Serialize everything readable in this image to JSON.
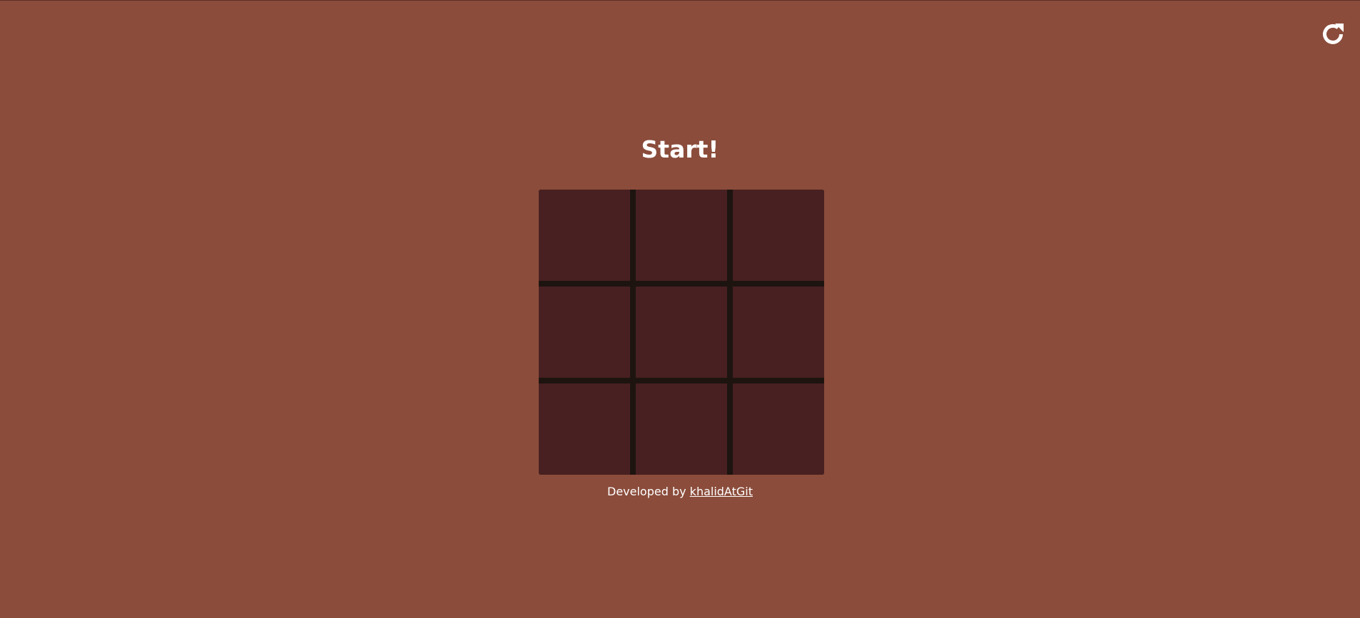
{
  "game": {
    "status_text": "Start!",
    "board": {
      "rows": 3,
      "cols": 3,
      "cells": [
        "",
        "",
        "",
        "",
        "",
        "",
        "",
        "",
        ""
      ]
    }
  },
  "controls": {
    "restart_icon": "restart-icon"
  },
  "footer": {
    "prefix": "Developed by",
    "author_link": "khalidAtGit"
  },
  "colors": {
    "background": "#8b4c3b",
    "cell": "#482021",
    "grid_lines": "#1d1410",
    "text": "#ffffff"
  }
}
